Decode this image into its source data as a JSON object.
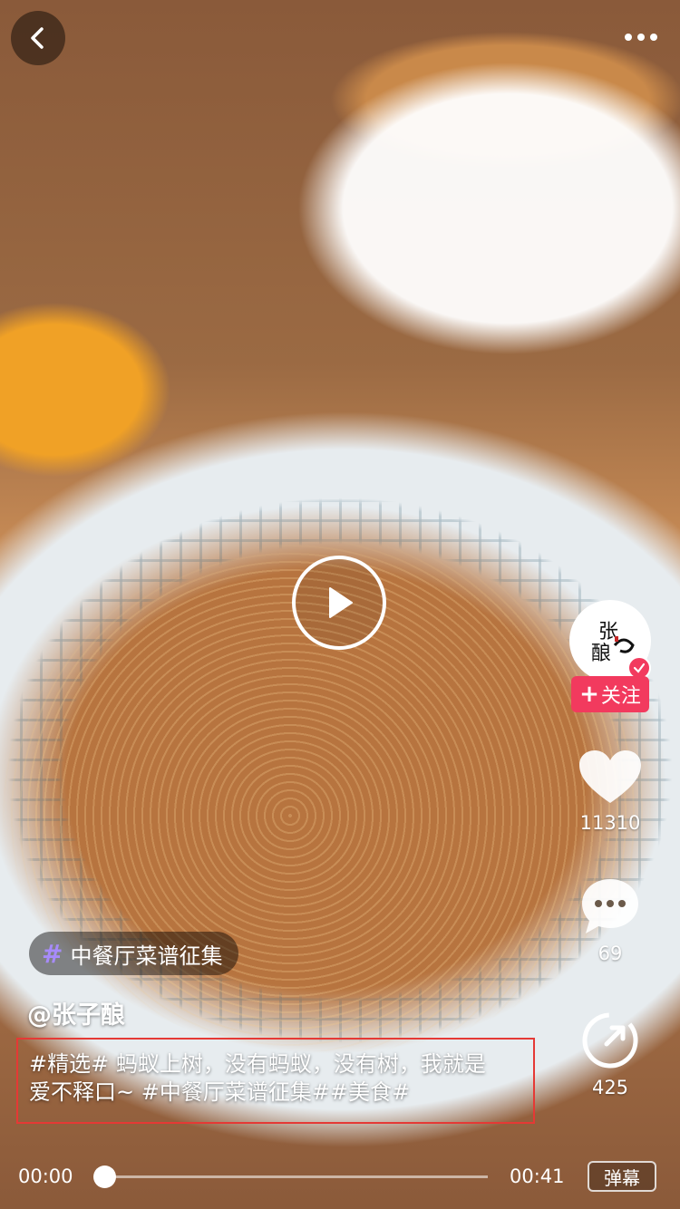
{
  "topic": {
    "tag": "中餐厅菜谱征集"
  },
  "author": {
    "handle": "@张子酿",
    "avatar_text": "张子酿"
  },
  "follow": {
    "label": "关注"
  },
  "actions": {
    "likes": "11310",
    "comments": "69",
    "shares": "425"
  },
  "caption": {
    "line1": "#精选# 蚂蚁上树，没有蚂蚁，没有树，我就是",
    "line2": "爱不释口~ #中餐厅菜谱征集##美食#"
  },
  "player": {
    "current_time": "00:00",
    "total_time": "00:41",
    "progress": 0,
    "danmaku_label": "弹幕"
  },
  "colors": {
    "accent": "#f23a5e",
    "highlight_border": "#e53935",
    "topic_hash": "#a78bfa"
  },
  "icons": [
    "back-icon",
    "more-icon",
    "play-icon",
    "heart-icon",
    "comment-icon",
    "share-icon",
    "verified-icon",
    "plus-icon"
  ]
}
